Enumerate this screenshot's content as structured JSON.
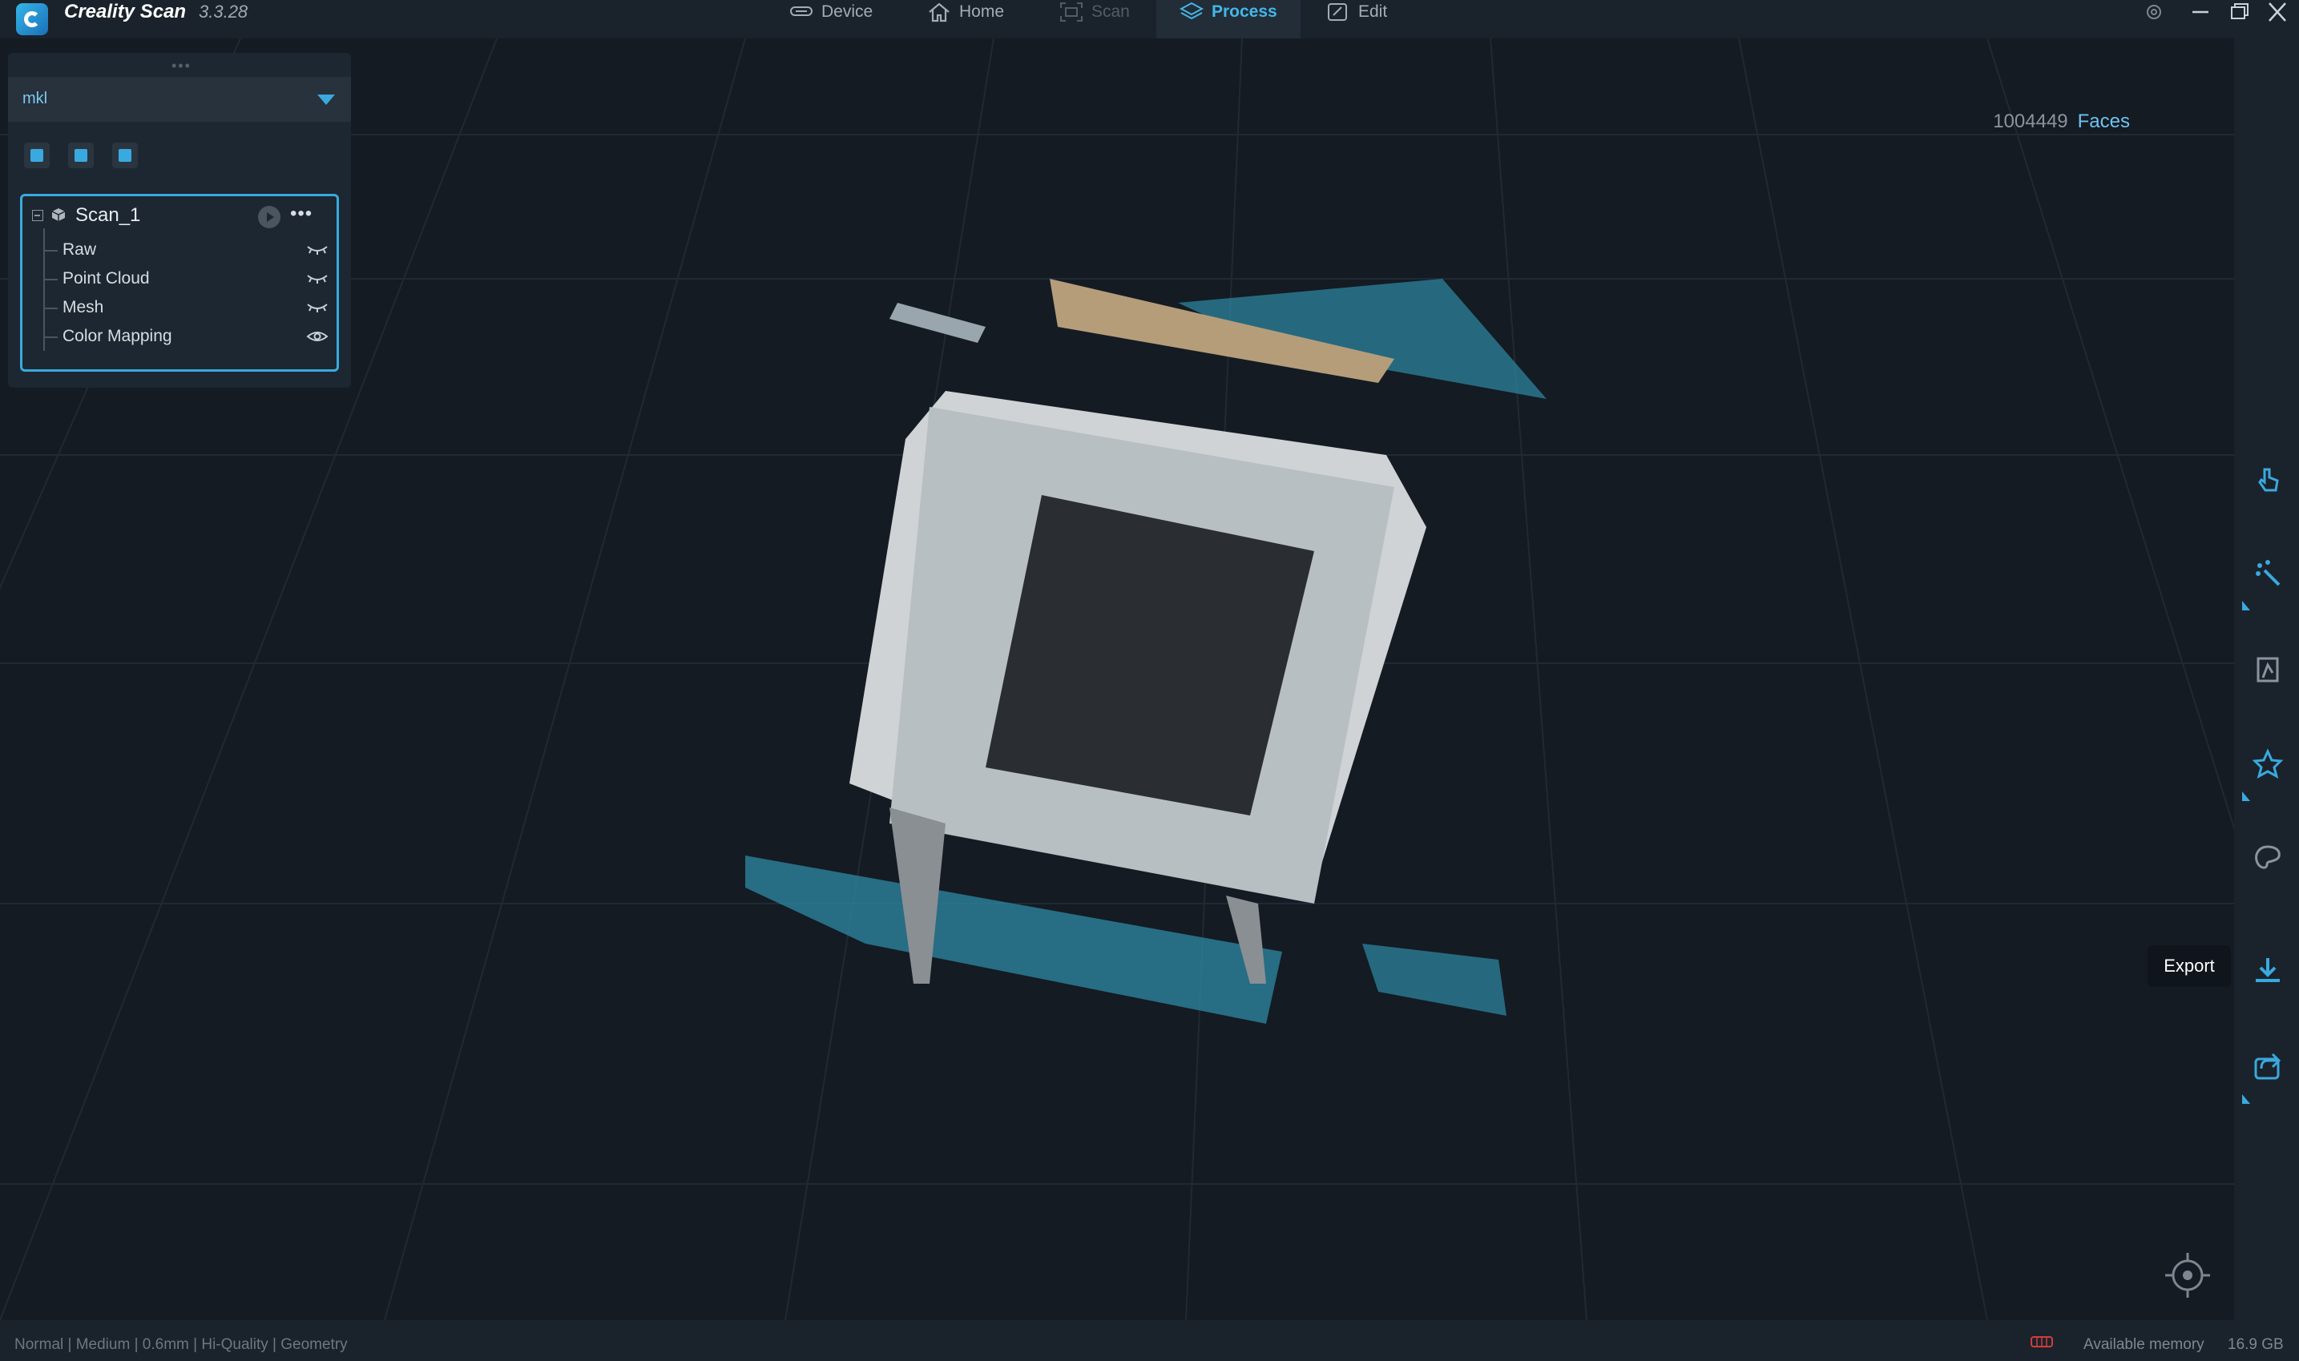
{
  "app": {
    "name": "Creality Scan",
    "version": "3.3.28"
  },
  "tabs": [
    {
      "label": "Device",
      "state": "normal"
    },
    {
      "label": "Home",
      "state": "normal"
    },
    {
      "label": "Scan",
      "state": "disabled"
    },
    {
      "label": "Process",
      "state": "active"
    },
    {
      "label": "Edit",
      "state": "normal"
    }
  ],
  "viewport": {
    "face_count": "1004449",
    "face_label": "Faces"
  },
  "project": {
    "name": "mkl"
  },
  "scan": {
    "name": "Scan_1",
    "layers": [
      {
        "label": "Raw",
        "visible": false
      },
      {
        "label": "Point Cloud",
        "visible": false
      },
      {
        "label": "Mesh",
        "visible": false
      },
      {
        "label": "Color Mapping",
        "visible": true
      }
    ]
  },
  "right_toolbar": {
    "export_tooltip": "Export",
    "icons": [
      "pointer-icon",
      "point-edit-icon",
      "mesh-icon",
      "texture-star-icon",
      "palette-icon",
      "download-icon",
      "share-icon"
    ]
  },
  "status": {
    "settings": "Normal | Medium | 0.6mm | Hi-Quality | Geometry",
    "memory_label": "Available memory",
    "memory_value": "16.9 GB"
  },
  "colors": {
    "accent": "#3aa9df",
    "background": "#141b23",
    "panel": "#1d2731"
  }
}
